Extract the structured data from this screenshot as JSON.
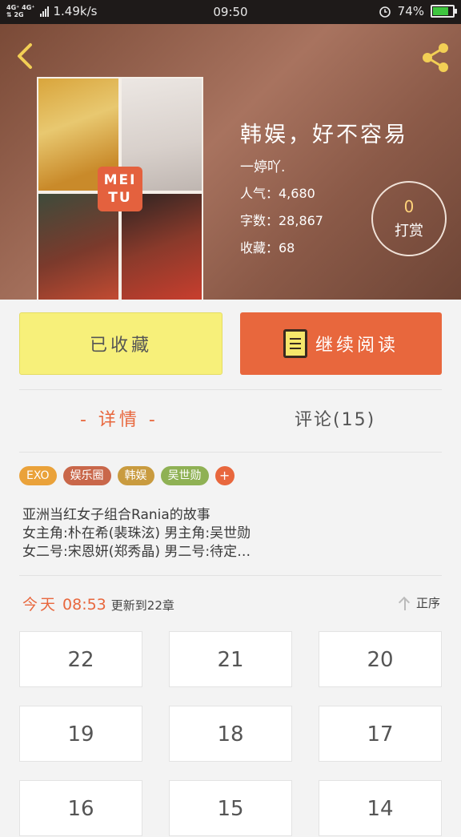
{
  "status_bar": {
    "network_top": "4G⁺ 4G⁺",
    "network_bottom": "⇅ 2G",
    "speed": "1.49k/s",
    "time": "09:50",
    "battery": "74%"
  },
  "book": {
    "title": "韩娱，好不容易",
    "author": "一婷吖.",
    "popularity": "人气：4,680",
    "word_count": "字数：28,867",
    "favorites": "收藏：68",
    "cover_logo_line1": "MEI",
    "cover_logo_line2": "TU"
  },
  "reward": {
    "count": "0",
    "label": "打赏"
  },
  "buttons": {
    "favorited": "已收藏",
    "continue_reading": "继续阅读"
  },
  "tabs": {
    "detail": "- 详情 -",
    "comments": "评论(15)"
  },
  "tags": [
    {
      "label": "EXO",
      "color": "#eaa23a"
    },
    {
      "label": "娱乐圈",
      "color": "#c9674a"
    },
    {
      "label": "韩娱",
      "color": "#c99b3f"
    },
    {
      "label": "吴世勋",
      "color": "#8fb154"
    }
  ],
  "tag_add": "+",
  "description": [
    "亚洲当红女子组合Rania的故事",
    "女主角:朴在希(裴珠泫)  男主角:吴世勋",
    "女二号:宋恩妍(郑秀晶)  男二号:待定…"
  ],
  "update": {
    "today": "今天",
    "time": "08:53",
    "text": "更新到22章"
  },
  "sort_label": "正序",
  "chapters": [
    "22",
    "21",
    "20",
    "19",
    "18",
    "17",
    "16",
    "15",
    "14"
  ]
}
